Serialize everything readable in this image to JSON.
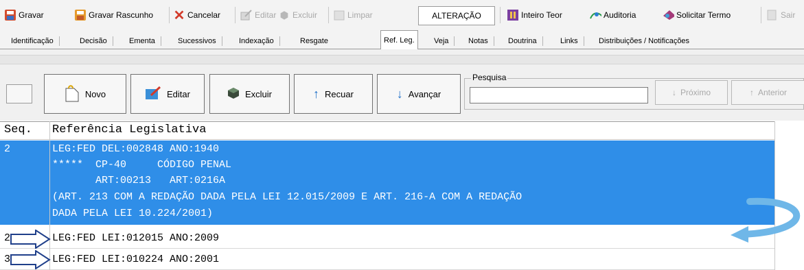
{
  "toolbar": {
    "gravar": "Gravar",
    "gravar_rascunho": "Gravar Rascunho",
    "cancelar": "Cancelar",
    "editar": "Editar",
    "excluir": "Excluir",
    "limpar": "Limpar",
    "mode": "ALTERAÇÃO",
    "inteiro_teor": "Inteiro Teor",
    "auditoria": "Auditoria",
    "solicitar_termo": "Solicitar Termo",
    "sair": "Sair"
  },
  "tabs": [
    "Identificação",
    "Decisão",
    "Ementa",
    "Sucessivos",
    "Indexação",
    "Resgate",
    "Ref. Leg.",
    "Veja",
    "Notas",
    "Doutrina",
    "Links",
    "Distribuições / Notificações"
  ],
  "active_tab": "Ref. Leg.",
  "actions": {
    "novo": "Novo",
    "editar": "Editar",
    "excluir": "Excluir",
    "recuar": "Recuar",
    "avancar": "Avançar"
  },
  "search": {
    "label": "Pesquisa",
    "value": "",
    "proximo": "Próximo",
    "anterior": "Anterior"
  },
  "grid": {
    "headers": [
      "Seq.",
      "Referência Legislativa"
    ],
    "selected_row": {
      "seq": "2",
      "lines": [
        "LEG:FED DEL:002848 ANO:1940",
        "*****  CP-40     CÓDIGO PENAL",
        "       ART:00213   ART:0216A",
        "(ART. 213 COM A REDAÇÃO DADA PELA LEI 12.015/2009 E ART. 216-A COM A REDAÇÃO",
        "DADA PELA LEI 10.224/2001)"
      ]
    },
    "rows": [
      {
        "seq": "2",
        "text": "LEG:FED LEI:012015 ANO:2009"
      },
      {
        "seq": "3",
        "text": "LEG:FED LEI:010224 ANO:2001"
      }
    ]
  },
  "colors": {
    "selection": "#2f8ee8",
    "annotation_arrow": "#6fb7e8"
  }
}
